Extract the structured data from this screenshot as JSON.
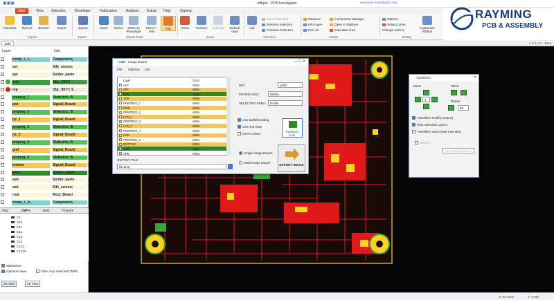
{
  "window": {
    "title": "edbjob - PCB-Investigator",
    "url": "www.pcb-investigator.com"
  },
  "tabs": [
    "Start",
    "View",
    "Selection",
    "Developer",
    "Fabrication",
    "Analysis",
    "Extras",
    "Help",
    "Signing"
  ],
  "ribbon": {
    "buttons": [
      "Favorites",
      "Recent",
      "Browse",
      "Import",
      "Export",
      "Zoom",
      "Select",
      "Select in Rectangle",
      "Select + Text",
      "Pan",
      "Home",
      "Contour",
      "Selected",
      "Default View",
      "List"
    ],
    "groups": [
      "Import",
      "Export",
      "Mouse Tools",
      "Zoom",
      "Selection",
      "Extras",
      "Setting"
    ],
    "selection_items": [
      "Clear Selection",
      "Reverse Selection",
      "Previous Selection"
    ],
    "extras_items": [
      "Measure",
      "Info Layer",
      "Net List",
      "Component Manager",
      "Open in Explorer",
      "Calculate Area"
    ],
    "setting_items": [
      "Options",
      "Setup Colors",
      "Change Units",
      "Customize Ribbon"
    ]
  },
  "logo": {
    "line1": "RAYMING",
    "line2": "PCB & ASSEMBLY"
  },
  "doc": {
    "tab": "pcb",
    "version": "V 5.1.0.4 - Beta"
  },
  "layers": {
    "headers": [
      "Layer",
      "Info"
    ],
    "rows": [
      {
        "name": "comp_+_t...",
        "info": "Component;",
        "bg": "#7fd3c8",
        "dot": ""
      },
      {
        "name": "sst",
        "info": "Silk_screen;",
        "bg": "#fbf7d6",
        "dot": ""
      },
      {
        "name": "spt",
        "info": "Solder_paste",
        "bg": "#fbf7d6",
        "dot": ""
      },
      {
        "name": "smt",
        "info": "Obj.: 1597;",
        "bg": "#3a9c3a",
        "dot": "#33b233"
      },
      {
        "name": "top",
        "info": "Obj.: 8577; S",
        "bg": "#f3ead0",
        "dot": "#e51b1b"
      },
      {
        "name": "prepreg_1",
        "info": "Dielectric; B",
        "bg": "#4cc94c",
        "dot": ""
      },
      {
        "name": "pwr",
        "info": "Signal; Board",
        "bg": "#f3c65a",
        "dot": ""
      },
      {
        "name": "prepreg_2",
        "info": "Dielectric; B",
        "bg": "#4cc94c",
        "dot": ""
      },
      {
        "name": "lyr_1",
        "info": "Signal; Board",
        "bg": "#f3c65a",
        "dot": ""
      },
      {
        "name": "prepreg_3",
        "info": "Dielectric; B",
        "bg": "#4cc94c",
        "dot": ""
      },
      {
        "name": "lyr_2",
        "info": "Signal; Board",
        "bg": "#f3c65a",
        "dot": ""
      },
      {
        "name": "prepreg_4",
        "info": "Dielectric; B",
        "bg": "#4cc94c",
        "dot": ""
      },
      {
        "name": "gnd",
        "info": "Signal; Board",
        "bg": "#f3c65a",
        "dot": ""
      },
      {
        "name": "prepreg_5",
        "info": "Dielectric; B",
        "bg": "#4cc94c",
        "dot": ""
      },
      {
        "name": "bottom",
        "info": "Signal; Board",
        "bg": "#f3c65a",
        "dot": ""
      },
      {
        "name": "smb",
        "info": "Solder_mask",
        "bg": "#2f8a2f",
        "dot": ""
      },
      {
        "name": "spb",
        "info": "Solder_paste",
        "bg": "#fbf7d6",
        "dot": ""
      },
      {
        "name": "ssb",
        "info": "Silk_screen;",
        "bg": "#fbf7d6",
        "dot": ""
      },
      {
        "name": "rout",
        "info": "Rout; Board",
        "bg": "#fbf7d6",
        "dot": ""
      },
      {
        "name": "comp_+_b...",
        "info": "Component;",
        "bg": "#7fd3c8",
        "dot": ""
      }
    ]
  },
  "bottom_tabs": [
    "Map",
    "CMP's",
    "Nets",
    "Properti"
  ],
  "chips": [
    "C1",
    "C10",
    "C11",
    "C12",
    "C13",
    "C14",
    "C141",
    "C1416"
  ],
  "options": [
    "Multiselect",
    "Optimize View",
    "Filter only Selected CMPs"
  ],
  "view_buttons": [
    "2D View",
    "3D View"
  ],
  "status": {
    "x": "X: 33.2mm",
    "y": "Y: 2.957"
  },
  "export_dialog": {
    "title": "ODB - Image Export",
    "menu": [
      "File",
      "Options",
      "Info"
    ],
    "columns": [
      "Layer",
      "Color"
    ],
    "rows": [
      {
        "layer": "SST",
        "color": "White",
        "bg": "#ffffff"
      },
      {
        "layer": "SPT",
        "color": "White",
        "bg": "#f3c65a"
      },
      {
        "layer": "SMT",
        "color": "White",
        "bg": "#2f8a2f"
      },
      {
        "layer": "TOP",
        "color": "White",
        "bg": "#f3c65a"
      },
      {
        "layer": "PREPREG_1",
        "color": "White",
        "bg": "#ffffff"
      },
      {
        "layer": "PWR",
        "color": "White",
        "bg": "#f3c65a"
      },
      {
        "layer": "PREPREG_2",
        "color": "White",
        "bg": "#ffffff"
      },
      {
        "layer": "LYR_1",
        "color": "White",
        "bg": "#f3c65a"
      },
      {
        "layer": "PREPREG_3",
        "color": "White",
        "bg": "#ffffff"
      },
      {
        "layer": "LYR_2",
        "color": "White",
        "bg": "#f3c65a"
      },
      {
        "layer": "PREPREG_4",
        "color": "White",
        "bg": "#ffffff"
      },
      {
        "layer": "GND",
        "color": "White",
        "bg": "#f3c65a"
      },
      {
        "layer": "PREPREG_5",
        "color": "White",
        "bg": "#ffffff"
      },
      {
        "layer": "BOTTOM",
        "color": "White",
        "bg": "#f3c65a"
      },
      {
        "layer": "SMB",
        "color": "White",
        "bg": "#2f8a2f"
      },
      {
        "layer": "SPB",
        "color": "White",
        "bg": "#ffffff"
      }
    ],
    "dpi_label": "DPI:",
    "dpi": "4000",
    "matrix_label": "MATRIX SIZE:",
    "matrix": "Mobile",
    "area_label": "SELECTED AREA:",
    "area": "Profile",
    "checks": [
      "Use Multithreading",
      "Use Anti Alias",
      "Invert Colors"
    ],
    "transfer_btn": "Transfer to PCB",
    "radios": [
      "Single Image Export",
      "Multi Image Export"
    ],
    "export_btn": "EXPORT IMAGE",
    "output_label": "OUTPUT FILE:",
    "output_value": "file.bmp"
  },
  "transform_dialog": {
    "title": "Transform",
    "move": "Move",
    "mirror": "Mirror",
    "rotate": "Rotate",
    "step": "1",
    "angle": "90",
    "checks": [
      "Transform Profil (contour)",
      "Only Selected Layers",
      "Transform and create new step"
    ],
    "move_label": "Move 0",
    "btn": "Do Transformation"
  }
}
